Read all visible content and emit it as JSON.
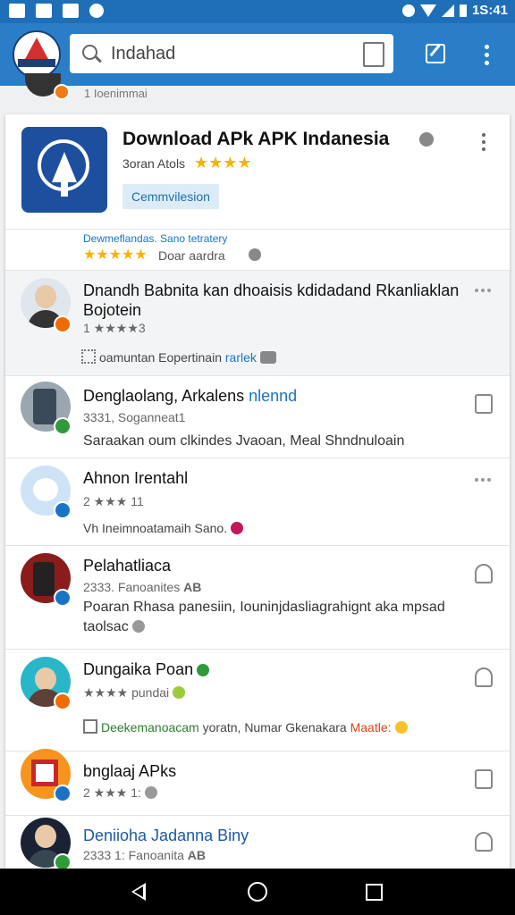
{
  "status_bar": {
    "time": "1S:41"
  },
  "search": {
    "value": "Indahad"
  },
  "peek_item": {
    "text": "1 Ioenimmai"
  },
  "app": {
    "title": "Download APk APK Indanesia",
    "developer": "3oran Atols",
    "stars": "★★★★",
    "chip": "Cemmvilesion"
  },
  "rating_summary": {
    "title": "Dewmeflandas. Sano tetratery",
    "stars": "★★★★★",
    "text": "Doar aardra"
  },
  "reviews": [
    {
      "name": "Dnandh Babnita kan dhoaisis kdidadand Rkanliaklan",
      "name2": "Bojotein",
      "meta": "1 ★★★★3",
      "footer": "oamuntan Eopertinain",
      "footer_accent": "rarlek"
    },
    {
      "name": "Denglaolang, Arkalens",
      "name_accent": "nlennd",
      "meta": "3331, Soganneat1",
      "body": "Saraakan oum clkindes Jvaoan, Meal Shndnuloain"
    },
    {
      "name": "Ahnon Irentahl",
      "meta": "2 ★★★ 11",
      "footer": "Vh Ineimnoatamaih Sano."
    },
    {
      "name": "Pelahatliaca",
      "meta": "2333. Fanoanites",
      "meta_tag": "AB",
      "body": "Poaran Rhasa panesiin, Iouninjdasliagrahignt aka mpsad",
      "body2": "taolsac"
    },
    {
      "name": "Dungaika Poan",
      "meta": "★★★★",
      "meta_tail": "pundai",
      "footer_green": "Deekemanoacam",
      "footer": "yoratn, Numar Gkenakara",
      "footer_orange": "Maatle:"
    },
    {
      "name": "bnglaaj APks",
      "meta": "2 ★★★ 1:"
    },
    {
      "name": "Deniioha Jadanna Biny",
      "meta": "2333 1: Fanoanita",
      "meta_tag": "AB"
    }
  ]
}
